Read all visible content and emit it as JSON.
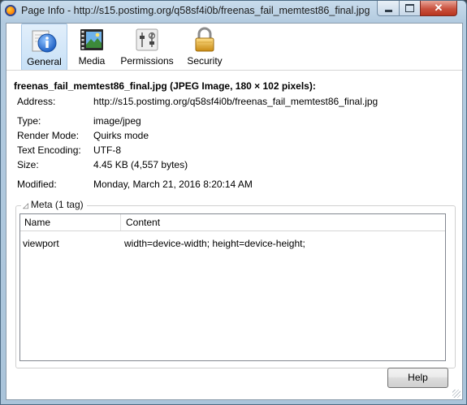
{
  "window": {
    "title": "Page Info - http://s15.postimg.org/q58sf4i0b/freenas_fail_memtest86_final.jpg",
    "controls": {
      "minimize": "",
      "maximize": "",
      "close": "✕"
    }
  },
  "tabs": [
    {
      "label": "General",
      "icon": "info-icon",
      "selected": true
    },
    {
      "label": "Media",
      "icon": "media-film-icon",
      "selected": false
    },
    {
      "label": "Permissions",
      "icon": "permissions-sliders-icon",
      "selected": false
    },
    {
      "label": "Security",
      "icon": "padlock-icon",
      "selected": false
    }
  ],
  "general": {
    "heading": "freenas_fail_memtest86_final.jpg (JPEG Image, 180 × 102 pixels):",
    "address_label": "Address:",
    "address_value": "http://s15.postimg.org/q58sf4i0b/freenas_fail_memtest86_final.jpg",
    "type_label": "Type:",
    "type_value": "image/jpeg",
    "render_label": "Render Mode:",
    "render_value": "Quirks mode",
    "encoding_label": "Text Encoding:",
    "encoding_value": "UTF-8",
    "size_label": "Size:",
    "size_value": "4.45 KB (4,557 bytes)",
    "modified_label": "Modified:",
    "modified_value": "Monday, March 21, 2016 8:20:14 AM"
  },
  "meta": {
    "legend": "Meta (1 tag)",
    "columns": {
      "name": "Name",
      "content": "Content"
    },
    "rows": [
      {
        "name": "viewport",
        "content": "width=device-width; height=device-height;"
      }
    ]
  },
  "buttons": {
    "help": "Help"
  },
  "colors": {
    "selected_tab": "#c7e0f6",
    "close_button": "#c9513e",
    "frame": "#b3cbe0"
  }
}
